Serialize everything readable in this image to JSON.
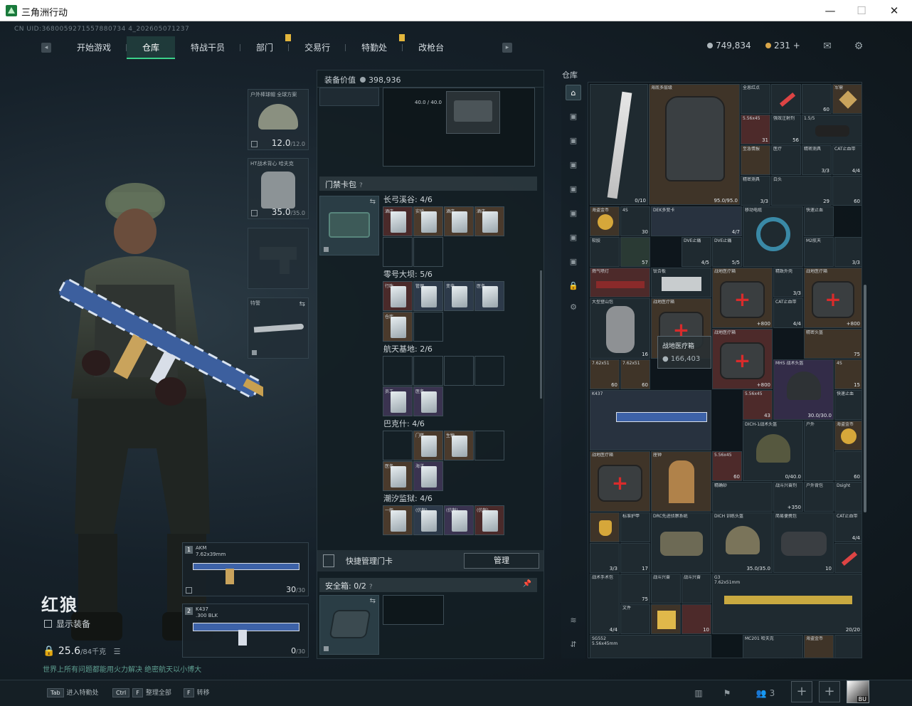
{
  "window": {
    "title": "三角洲行动",
    "minimize": "—",
    "maximize": "☐",
    "close": "✕"
  },
  "uid": "CN UID:3680059271557880734 4_202605071237",
  "tabs": [
    {
      "label": "开始游戏",
      "active": false,
      "flag": false
    },
    {
      "label": "仓库",
      "active": true,
      "flag": false
    },
    {
      "label": "特战干员",
      "active": false,
      "flag": false
    },
    {
      "label": "部门",
      "active": false,
      "flag": true
    },
    {
      "label": "交易行",
      "active": false,
      "flag": false
    },
    {
      "label": "特勤处",
      "active": false,
      "flag": true
    },
    {
      "label": "改枪台",
      "active": false,
      "flag": false
    }
  ],
  "currency": {
    "primary": "749,834",
    "secondary": "231",
    "plus": "+"
  },
  "operator": {
    "name": "红狼",
    "show_gear_label": "显示装备",
    "weight": "25.6",
    "weight_max": "/84千克",
    "motto": "世界上所有问题都能用火力解决 绝密航天以小博大"
  },
  "gear": {
    "helmet": {
      "label": "户外棒球帽 全球方案",
      "value": "12.0",
      "max": "/12.0"
    },
    "armor": {
      "label": "HT战术背心 哈夫克",
      "value": "35.0",
      "max": "/35.0"
    },
    "melee": {
      "label": "特警"
    }
  },
  "weapons": [
    {
      "num": "1",
      "name": "AKM",
      "sub": "7.62x39mm",
      "ammo": "30",
      "max": "/30"
    },
    {
      "num": "2",
      "name": "K437",
      "sub": ".300 BLK",
      "ammo": "0",
      "max": "/30"
    }
  ],
  "mid": {
    "value_label": "装备价值",
    "value": "398,936",
    "top_item_durability": "40.0 / 40.0",
    "keycard_section": "门禁卡包",
    "keycard_hint": "?",
    "locations": [
      {
        "name": "长弓溪谷: 4/6",
        "cards": [
          "酒店",
          "实验",
          "酒店",
          "酒店"
        ]
      },
      {
        "name": "零号大坝: 5/6",
        "cards": [
          "行政",
          "管理",
          "变电",
          "医务",
          "仓库"
        ]
      },
      {
        "name": "航天基地: 2/6",
        "cards": [
          "员工",
          "医务"
        ]
      },
      {
        "name": "巴克什: 4/6",
        "cards": [
          "门楼",
          "生物",
          "医务",
          "海洋"
        ]
      },
      {
        "name": "潮汐监狱: 4/6",
        "cards": [
          "一般",
          "(仿制)",
          "(仿制)",
          "(仿制)"
        ]
      }
    ],
    "quick_manage": "快捷管理门卡",
    "manage_btn": "管理",
    "safebox_label": "安全箱:",
    "safebox_value": "0/2",
    "safebox_hint": "?"
  },
  "warehouse": {
    "title": "仓库",
    "items": {
      "rifle": {
        "count": "0/10"
      },
      "vest": {
        "name": "海底多层级",
        "sub": "阿萨拉",
        "count": "95.0/95.0"
      },
      "a1": {
        "name": "全息红点",
        "count": ""
      },
      "a2": {
        "name": "",
        "count": ""
      },
      "a3": {
        "name": "60",
        "count": "60"
      },
      "a4": {
        "name": "军需",
        "count": ""
      },
      "b1": {
        "name": "5.56x45",
        "count": "31"
      },
      "b2": {
        "name": "强效注射剂",
        "count": "56"
      },
      "b3": {
        "name": "1.5/5",
        "count": ""
      },
      "c1": {
        "name": "至急情报",
        "count": ""
      },
      "c2": {
        "name": "医疗",
        "count": ""
      },
      "c3": {
        "name": "精密测具",
        "count": "3/3"
      },
      "c4": {
        "name": "CAT止血带",
        "count": "4/4"
      },
      "d1": {
        "name": "精密测具",
        "count": "3/3"
      },
      "d2": {
        "name": "白头",
        "count": "29"
      },
      "d3": {
        "name": "60",
        "count": "60"
      },
      "e1": {
        "name": "海盗金币",
        "count": ""
      },
      "e2": {
        "name": "4S",
        "count": "30"
      },
      "e3": {
        "name": "DEK多变卡",
        "count": "4/7"
      },
      "e4": {
        "name": "移动电缆",
        "count": ""
      },
      "e5": {
        "name": "快速止血",
        "count": ""
      },
      "f1": {
        "name": "软胶",
        "count": "57"
      },
      "f2": {
        "name": "DVE止痛",
        "count": "4/5"
      },
      "f3": {
        "name": "DVE止痛",
        "count": "5/5"
      },
      "f4": {
        "name": "M2航天",
        "count": "3/3"
      },
      "g1": {
        "name": "燃气喷灯",
        "count": ""
      },
      "g2": {
        "name": "钛合板",
        "count": ""
      },
      "g3": {
        "name": "战地医疗箱",
        "count": "+800"
      },
      "g4": {
        "name": "精致外壳",
        "count": "3/3"
      },
      "g5": {
        "name": "战地医疗箱",
        "count": "+800"
      },
      "h1": {
        "name": "大型登山包",
        "sub": "阿萨拉",
        "count": "16"
      },
      "h2": {
        "name": "战地医疗箱",
        "count": ""
      },
      "h3": {
        "name": "CAT止血带",
        "count": "4/4"
      },
      "h4": {
        "name": "精密头盔",
        "count": "75"
      },
      "i1": {
        "name": "7.62x51",
        "count": "60"
      },
      "i2": {
        "name": "7.62x51",
        "count": "60"
      },
      "i3": {
        "name": "战地医疗箱",
        "count": "+800"
      },
      "i4": {
        "name": "MHS 战术头盔",
        "sub": "哈夫克",
        "count": "30.0/30.0"
      },
      "i5": {
        "name": "4S",
        "count": "15"
      },
      "j1": {
        "name": "K437",
        "sub": ".300 BLK",
        "count": ""
      },
      "j2": {
        "name": "5.56x45",
        "count": "43"
      },
      "j3": {
        "name": "快速止血",
        "count": ""
      },
      "k1": {
        "name": "DICH-1战术头盔",
        "sub": "阿萨拉",
        "count": "0/40.0"
      },
      "k2": {
        "name": "户外",
        "count": ""
      },
      "k3": {
        "name": "海盗金币",
        "count": ""
      },
      "l1": {
        "name": "战地医疗箱",
        "count": ""
      },
      "l2": {
        "name": "座钟",
        "count": ""
      },
      "l3": {
        "name": "5.56x45",
        "count": "60"
      },
      "l4": {
        "name": "户外背包",
        "count": ""
      },
      "l5": {
        "name": "60",
        "count": "60"
      },
      "m1": {
        "name": "精确砂",
        "count": ""
      },
      "m2": {
        "name": "战斗兴奋剂",
        "count": "+350"
      },
      "m3": {
        "name": "Dsight",
        "count": ""
      },
      "n1": {
        "name": "",
        "count": ""
      },
      "n2": {
        "name": "标准护甲",
        "count": ""
      },
      "n3": {
        "name": "DRC先进侦察系统",
        "sub": "三角洲",
        "count": ""
      },
      "n4": {
        "name": "DICH 训练头盔",
        "sub": "三角洲",
        "count": "35.0/35.0"
      },
      "n5": {
        "name": "简易便携包",
        "sub": "阿萨拉",
        "count": "10"
      },
      "n6": {
        "name": "CAT止血带",
        "count": "4/4"
      },
      "o1": {
        "name": "精致外壳",
        "count": "3/3"
      },
      "o2": {
        "name": "",
        "count": "17"
      },
      "o3": {
        "name": "战斗兴奋剂",
        "count": ""
      },
      "p1": {
        "name": "战术手术包",
        "count": "4/4"
      },
      "p2": {
        "name": "战斗兴奋",
        "count": "75"
      },
      "p3": {
        "name": "战斗兴奋",
        "count": ""
      },
      "p4": {
        "name": "G3",
        "sub": "7.62x51mm",
        "count": "20/20"
      },
      "q1": {
        "name": "文件",
        "count": ""
      },
      "q2": {
        "name": "",
        "count": "10"
      },
      "r1": {
        "name": "SG552",
        "sub": "5.56x45mm",
        "count": ""
      },
      "r2": {
        "name": "MC201 哈夫克",
        "count": ""
      },
      "r3": {
        "name": "海盗金币",
        "count": ""
      },
      "r4": {
        "name": "",
        "count": ""
      }
    },
    "tooltip": {
      "name": "战地医疗箱",
      "price": "166,403"
    }
  },
  "bottom": {
    "hotkeys": [
      {
        "key": "Tab",
        "label": "进入特勤处"
      },
      {
        "key": "Ctrl",
        "key2": "F",
        "label": "整理全部"
      },
      {
        "key": "F",
        "label": "转移"
      }
    ],
    "social_count": "3",
    "avatar_tag": "BU"
  }
}
